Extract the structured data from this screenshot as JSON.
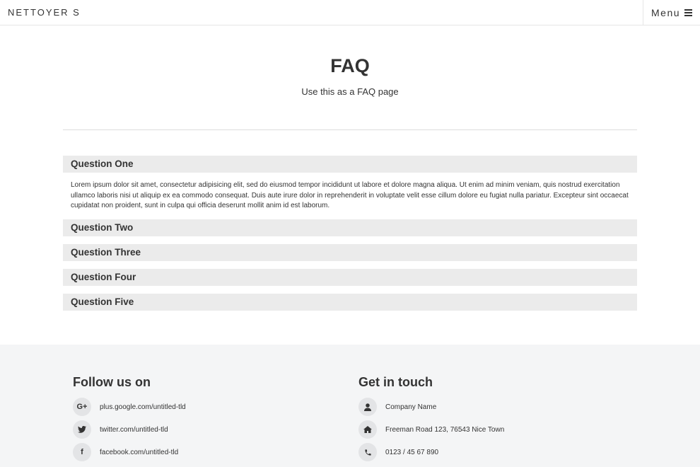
{
  "header": {
    "brand": "NETTOYER S",
    "menu_label": "Menu"
  },
  "hero": {
    "title": "FAQ",
    "subtitle": "Use this as a FAQ page"
  },
  "faq": {
    "items": [
      {
        "question": "Question One",
        "answer": "Lorem ipsum dolor sit amet, consectetur adipisicing elit, sed do eiusmod tempor incididunt ut labore et dolore magna aliqua. Ut enim ad minim veniam, quis nostrud exercitation ullamco laboris nisi ut aliquip ex ea commodo consequat. Duis aute irure dolor in reprehenderit in voluptate velit esse cillum dolore eu fugiat nulla pariatur. Excepteur sint occaecat cupidatat non proident, sunt in culpa qui officia deserunt mollit anim id est laborum.",
        "expanded": true
      },
      {
        "question": "Question Two",
        "expanded": false
      },
      {
        "question": "Question Three",
        "expanded": false
      },
      {
        "question": "Question Four",
        "expanded": false
      },
      {
        "question": "Question Five",
        "expanded": false
      }
    ]
  },
  "footer": {
    "follow": {
      "title": "Follow us on",
      "links": [
        {
          "icon": "google-plus-icon",
          "glyph": "G+",
          "text": "plus.google.com/untitled-tld"
        },
        {
          "icon": "twitter-icon",
          "glyph": "🐦",
          "text": "twitter.com/untitled-tld"
        },
        {
          "icon": "facebook-icon",
          "glyph": "f",
          "text": "facebook.com/untitled-tld"
        }
      ]
    },
    "contact": {
      "title": "Get in touch",
      "items": [
        {
          "icon": "user-icon",
          "glyph": "👤",
          "text": "Company Name"
        },
        {
          "icon": "home-icon",
          "glyph": "⌂",
          "text": "Freeman Road 123, 76543 Nice Town"
        },
        {
          "icon": "phone-icon",
          "glyph": "✆",
          "text": "0123 / 45 67 890"
        }
      ]
    }
  }
}
